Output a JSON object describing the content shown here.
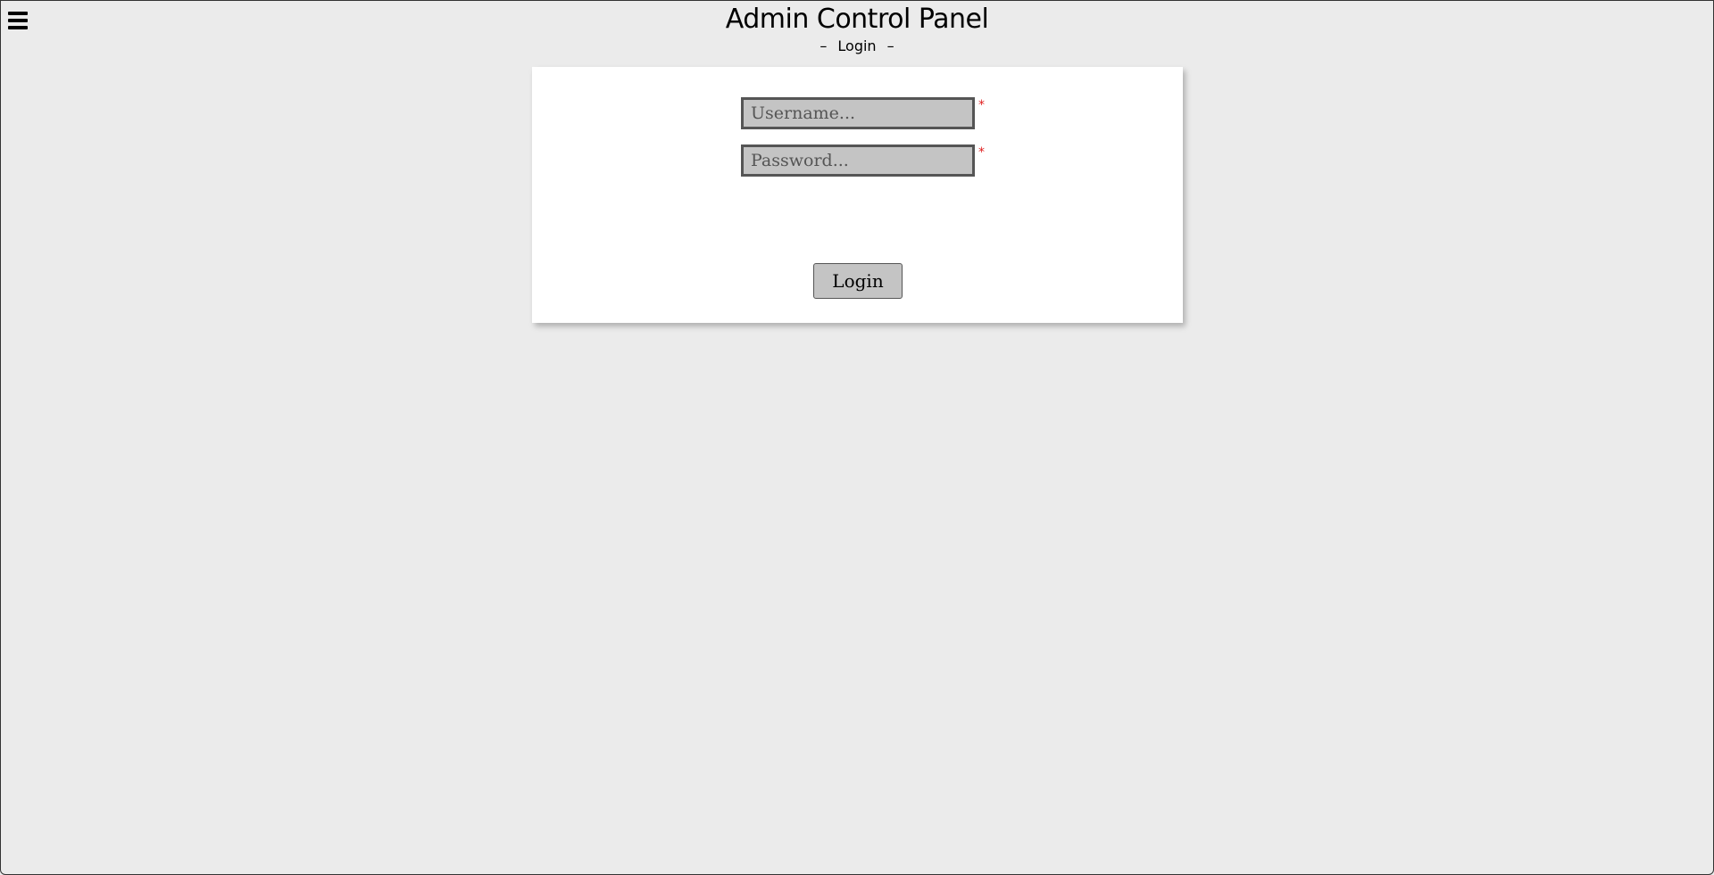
{
  "header": {
    "title": "Admin Control Panel",
    "subtitle": "Login",
    "subtitle_dash_left": "–",
    "subtitle_dash_right": "–"
  },
  "menu": {
    "icon": "hamburger-menu-icon"
  },
  "form": {
    "username": {
      "placeholder": "Username...",
      "value": "",
      "required_mark": "*"
    },
    "password": {
      "placeholder": "Password...",
      "value": "",
      "required_mark": "*"
    },
    "submit_label": "Login"
  },
  "colors": {
    "background": "#ebebeb",
    "card": "#ffffff",
    "input_fill": "#c4c4c4",
    "input_border": "#555555",
    "required": "#e02020"
  }
}
